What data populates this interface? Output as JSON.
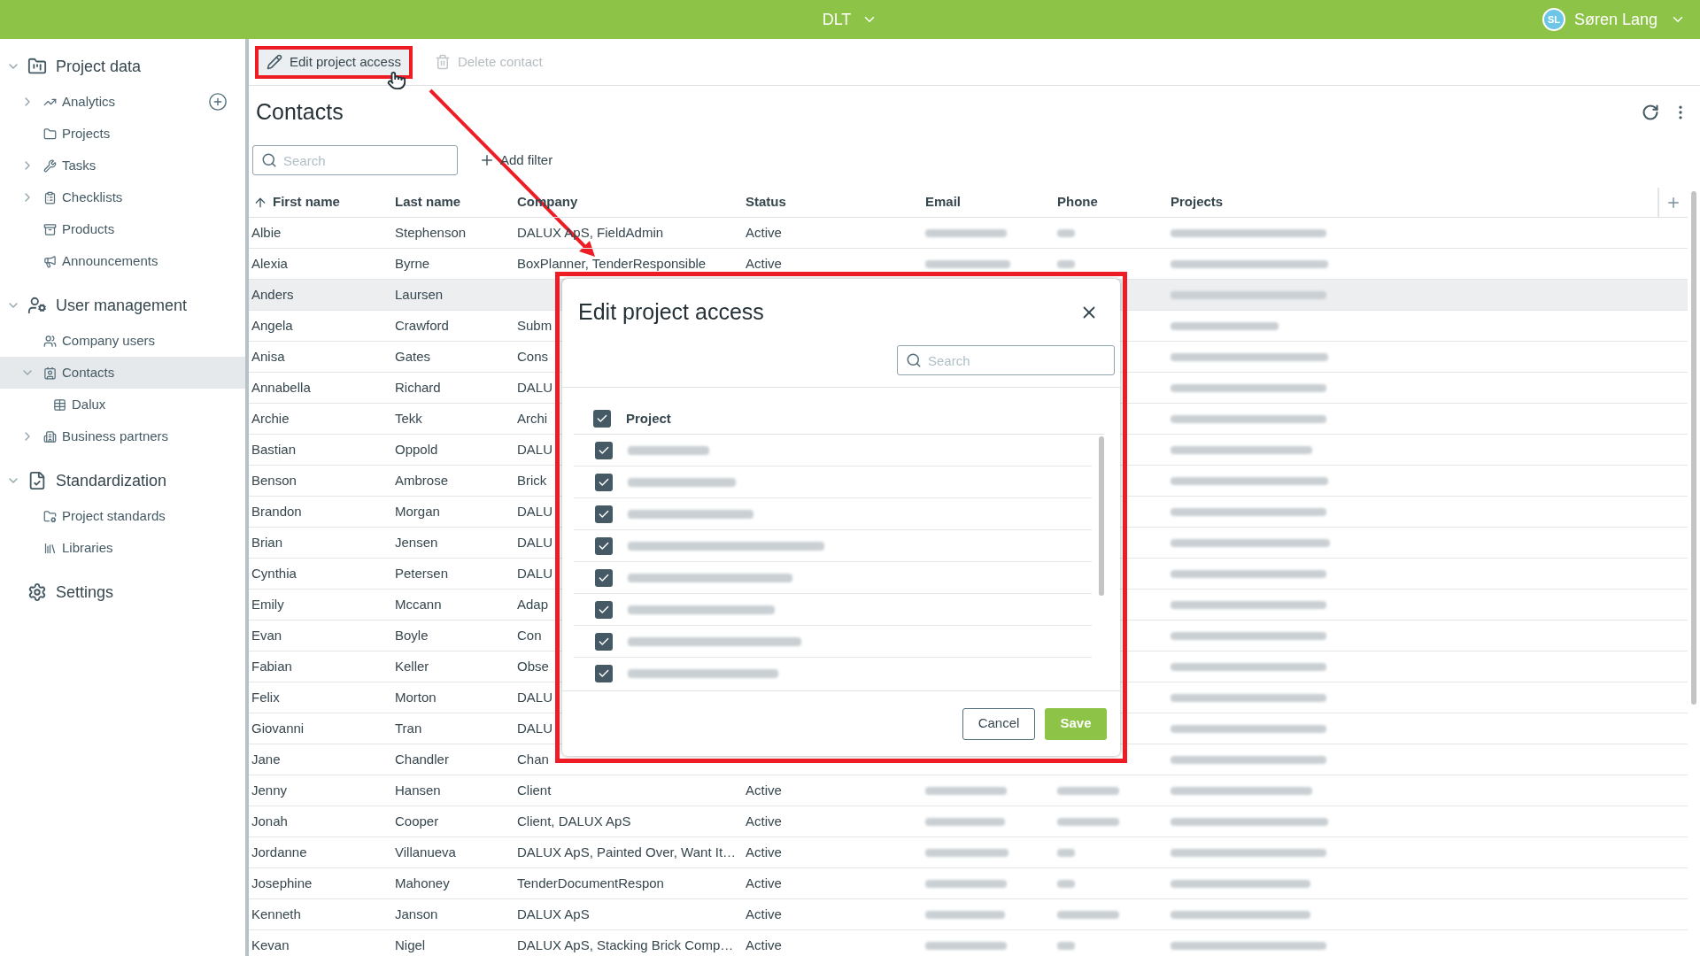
{
  "topbar": {
    "app": "DLT",
    "user": {
      "initials": "SL",
      "name": "Søren Lang"
    }
  },
  "sidebar": {
    "sections": [
      {
        "label": "Project data",
        "expanded": true,
        "items": [
          {
            "label": "Analytics",
            "expanded": false,
            "selected": false,
            "has_add": true
          },
          {
            "label": "Projects",
            "selected": false
          },
          {
            "label": "Tasks",
            "expanded": false,
            "selected": false
          },
          {
            "label": "Checklists",
            "expanded": false,
            "selected": false
          },
          {
            "label": "Products",
            "selected": false
          },
          {
            "label": "Announcements",
            "selected": false
          }
        ]
      },
      {
        "label": "User management",
        "expanded": true,
        "items": [
          {
            "label": "Company users",
            "selected": false
          },
          {
            "label": "Contacts",
            "expanded": true,
            "selected": true,
            "children": [
              {
                "label": "Dalux",
                "selected": false
              }
            ]
          },
          {
            "label": "Business partners",
            "expanded": false,
            "selected": false
          }
        ]
      },
      {
        "label": "Standardization",
        "expanded": true,
        "items": [
          {
            "label": "Project standards",
            "selected": false
          },
          {
            "label": "Libraries",
            "selected": false
          }
        ]
      },
      {
        "label": "Settings"
      }
    ]
  },
  "toolbar": {
    "buttons": [
      {
        "label": "Edit project access",
        "disabled": false,
        "highlighted": true
      },
      {
        "label": "Delete contact",
        "disabled": true,
        "highlighted": false
      }
    ]
  },
  "page": {
    "title": "Contacts",
    "search": {
      "placeholder": "Search"
    },
    "add_filter": "Add filter"
  },
  "table": {
    "columns": [
      {
        "label": "First name",
        "sorted": true
      },
      {
        "label": "Last name"
      },
      {
        "label": "Company"
      },
      {
        "label": "Status"
      },
      {
        "label": "Email"
      },
      {
        "label": "Phone"
      },
      {
        "label": "Projects"
      }
    ],
    "rows": [
      {
        "first": "Albie",
        "last": "Stephenson",
        "company": "DALUX ApS, FieldAdmin",
        "status": "Active",
        "selected": false
      },
      {
        "first": "Alexia",
        "last": "Byrne",
        "company": "BoxPlanner, TenderResponsible",
        "status": "Active",
        "selected": false
      },
      {
        "first": "Anders",
        "last": "Laursen",
        "selected": true
      },
      {
        "first": "Angela",
        "last": "Crawford",
        "company": "Subm",
        "selected": false
      },
      {
        "first": "Anisa",
        "last": "Gates",
        "company": "Cons",
        "selected": false
      },
      {
        "first": "Annabella",
        "last": "Richard",
        "company": "DALU",
        "selected": false
      },
      {
        "first": "Archie",
        "last": "Tekk",
        "company": "Archi",
        "selected": false
      },
      {
        "first": "Bastian",
        "last": "Oppold",
        "company": "DALU",
        "selected": false
      },
      {
        "first": "Benson",
        "last": "Ambrose",
        "company": "Brick",
        "selected": false
      },
      {
        "first": "Brandon",
        "last": "Morgan",
        "company": "DALU",
        "selected": false
      },
      {
        "first": "Brian",
        "last": "Jensen",
        "company": "DALU",
        "selected": false
      },
      {
        "first": "Cynthia",
        "last": "Petersen",
        "company": "DALU",
        "selected": false
      },
      {
        "first": "Emily",
        "last": "Mccann",
        "company": "Adap",
        "selected": false
      },
      {
        "first": "Evan",
        "last": "Boyle",
        "company": "Con",
        "selected": false
      },
      {
        "first": "Fabian",
        "last": "Keller",
        "company": "Obse",
        "selected": false
      },
      {
        "first": "Felix",
        "last": "Morton",
        "company": "DALU",
        "selected": false
      },
      {
        "first": "Giovanni",
        "last": "Tran",
        "company": "DALU",
        "selected": false
      },
      {
        "first": "Jane",
        "last": "Chandler",
        "company": "Chan",
        "selected": false
      },
      {
        "first": "Jenny",
        "last": "Hansen",
        "company": "Client",
        "status": "Active",
        "selected": false
      },
      {
        "first": "Jonah",
        "last": "Cooper",
        "company": "Client, DALUX ApS",
        "status": "Active",
        "selected": false
      },
      {
        "first": "Jordanne",
        "last": "Villanueva",
        "company": "DALUX ApS, Painted Over, Want It…",
        "status": "Active",
        "selected": false
      },
      {
        "first": "Josephine",
        "last": "Mahoney",
        "company": "TenderDocumentRespon",
        "status": "Active",
        "selected": false
      },
      {
        "first": "Kenneth",
        "last": "Janson",
        "company": "DALUX ApS",
        "status": "Active",
        "selected": false
      },
      {
        "first": "Kevan",
        "last": "Nigel",
        "company": "DALUX ApS, Stacking Brick Comp…",
        "status": "Active",
        "selected": false
      }
    ]
  },
  "dialog": {
    "title": "Edit project access",
    "highlighted": true,
    "search": {
      "placeholder": "Search"
    },
    "header": {
      "label": "Project",
      "checked": true
    },
    "projects": [
      {
        "checked": true
      },
      {
        "checked": true
      },
      {
        "checked": true
      },
      {
        "checked": true
      },
      {
        "checked": true
      },
      {
        "checked": true
      },
      {
        "checked": true
      },
      {
        "checked": true
      }
    ],
    "cancel": "Cancel",
    "save": "Save"
  }
}
